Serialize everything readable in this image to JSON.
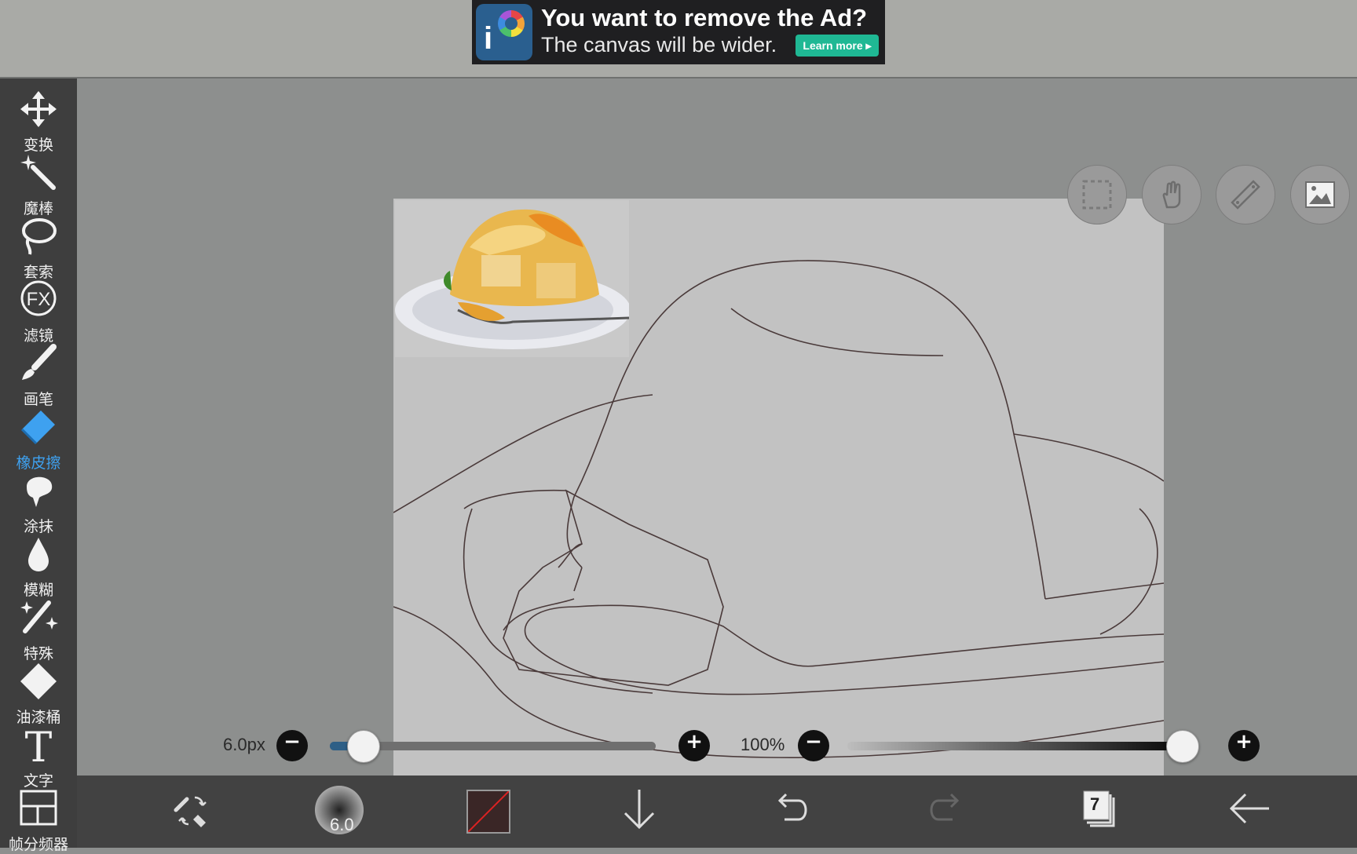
{
  "ad": {
    "title": "You want to remove the Ad?",
    "subtitle": "The canvas will be wider.",
    "cta": "Learn more ▸",
    "logo_text": "i"
  },
  "tools": [
    {
      "label": "变换",
      "icon": "move-icon"
    },
    {
      "label": "魔棒",
      "icon": "magic-wand-icon"
    },
    {
      "label": "套索",
      "icon": "lasso-icon"
    },
    {
      "label": "滤镜",
      "icon": "fx-filter-icon"
    },
    {
      "label": "画笔",
      "icon": "brush-icon"
    },
    {
      "label": "橡皮擦",
      "icon": "eraser-icon",
      "active": true
    },
    {
      "label": "涂抹",
      "icon": "smudge-icon"
    },
    {
      "label": "模糊",
      "icon": "blur-drop-icon"
    },
    {
      "label": "特殊",
      "icon": "special-wand-icon"
    },
    {
      "label": "油漆桶",
      "icon": "paint-bucket-icon"
    },
    {
      "label": "文字",
      "icon": "text-icon"
    },
    {
      "label": "帧分频器",
      "icon": "frame-divider-icon"
    }
  ],
  "fx_glyph": "FX",
  "text_glyph": "T",
  "top_buttons": [
    "selection-icon",
    "hand-gesture-icon",
    "ruler-icon",
    "image-icon"
  ],
  "sliders": {
    "size_label": "6.0px",
    "size_fraction": 0.1,
    "opacity_label": "100%",
    "opacity_fraction": 1.0,
    "minus": "−",
    "plus": "+"
  },
  "bottom": {
    "brush_size": "6.0",
    "layer_count": "7",
    "color": "#3a2626",
    "accent": "#3ea1f0"
  }
}
